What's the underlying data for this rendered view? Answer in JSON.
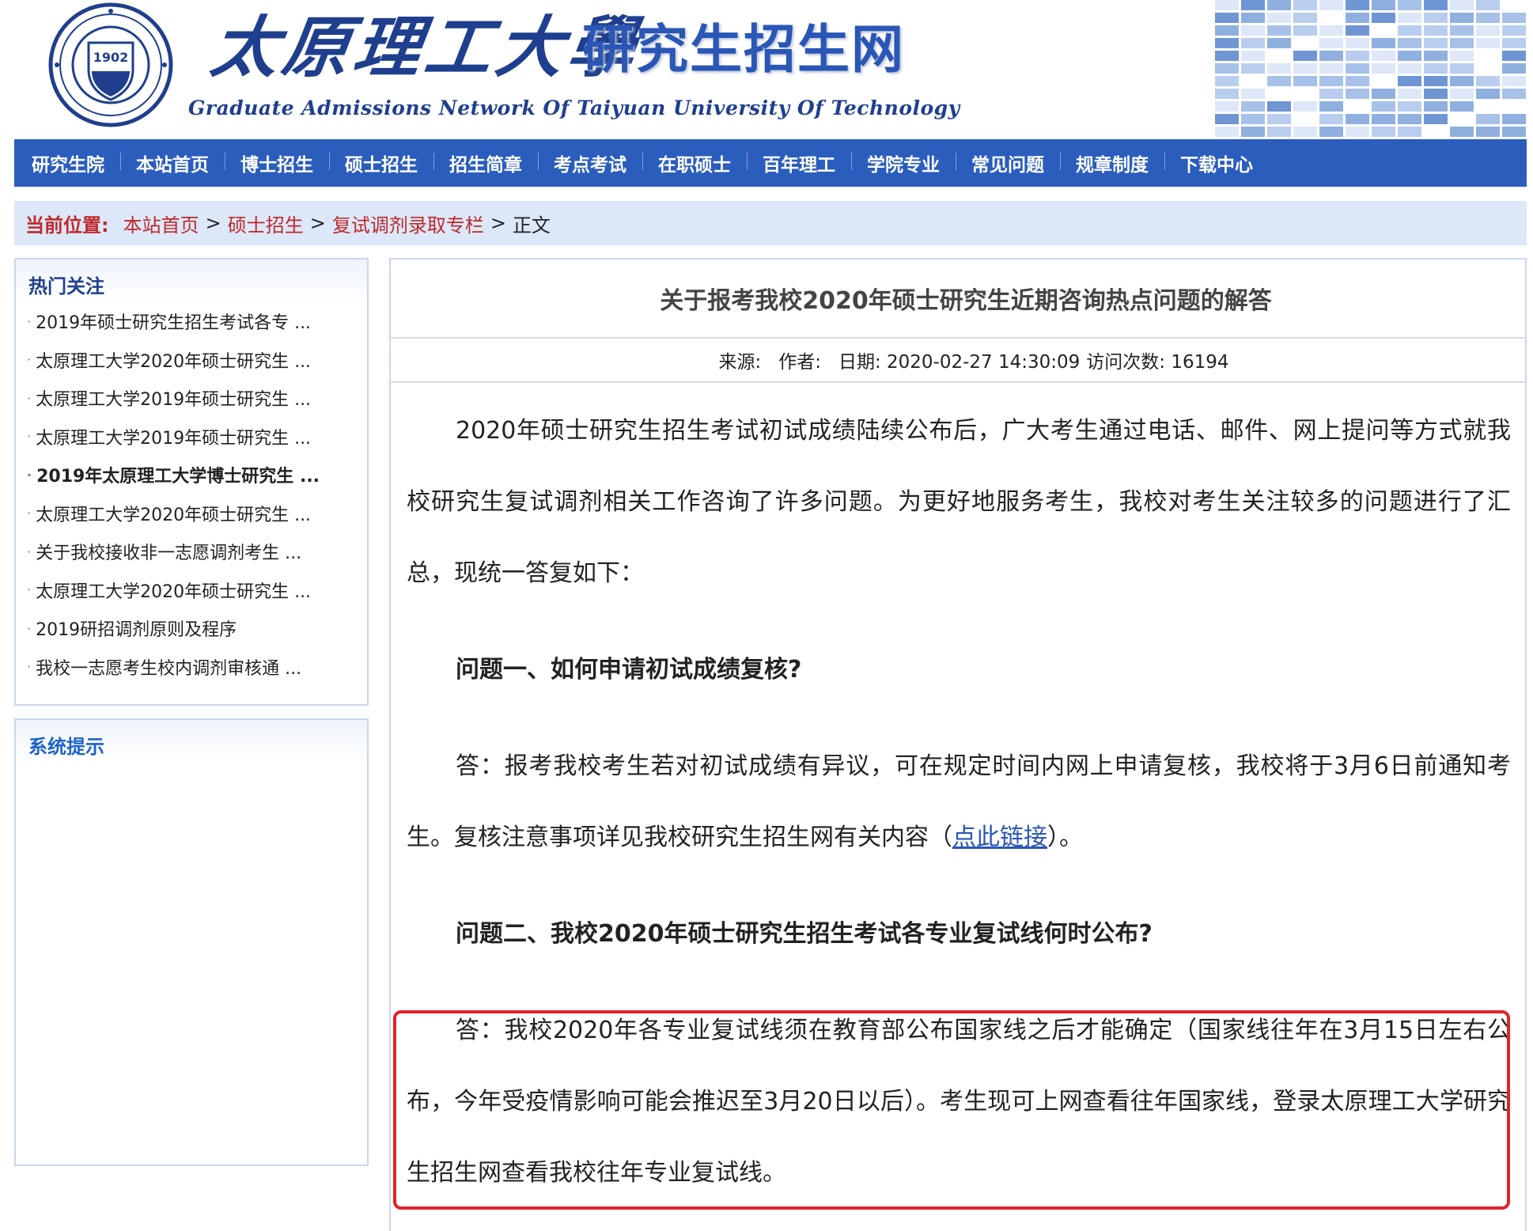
{
  "header": {
    "seal_year": "1902",
    "logo_cn": "太原理工大學",
    "site_name": "研究生招生网",
    "logo_en": "Graduate Admissions Network Of Taiyuan University Of Technology"
  },
  "nav": {
    "items": [
      "研究生院",
      "本站首页",
      "博士招生",
      "硕士招生",
      "招生简章",
      "考点考试",
      "在职硕士",
      "百年理工",
      "学院专业",
      "常见问题",
      "规章制度",
      "下载中心"
    ]
  },
  "breadcrumb": {
    "label": "当前位置:",
    "items": [
      "本站首页",
      "硕士招生",
      "复试调剂录取专栏"
    ],
    "separator": ">",
    "current": "正文"
  },
  "sidebar": {
    "hot_title": "热门关注",
    "hot_items": [
      "2019年硕士研究生招生考试各专 ...",
      "太原理工大学2020年硕士研究生 ...",
      "太原理工大学2019年硕士研究生 ...",
      "太原理工大学2019年硕士研究生 ...",
      "2019年太原理工大学博士研究生 ...",
      "太原理工大学2020年硕士研究生 ...",
      "关于我校接收非一志愿调剂考生 ...",
      "太原理工大学2020年硕士研究生 ...",
      "2019研招调剂原则及程序",
      "我校一志愿考生校内调剂审核通 ..."
    ],
    "system_title": "系统提示"
  },
  "article": {
    "title": "关于报考我校2020年硕士研究生近期咨询热点问题的解答",
    "meta": {
      "source": "来源:",
      "author": "作者:",
      "date": "日期: 2020-02-27 14:30:09",
      "visits": "访问次数: 16194"
    },
    "intro": "2020年硕士研究生招生考试初试成绩陆续公布后，广大考生通过电话、邮件、网上提问等方式就我校研究生复试调剂相关工作咨询了许多问题。为更好地服务考生，我校对考生关注较多的问题进行了汇总，现统一答复如下：",
    "q1": "问题一、如何申请初试成绩复核?",
    "a1_text": "答：报考我校考生若对初试成绩有异议，可在规定时间内网上申请复核，我校将于3月6日前通知考生。复核注意事项详见我校研究生招生网有关内容（",
    "a1_link": "点此链接",
    "a1_tail": "）。",
    "q2": "问题二、我校2020年硕士研究生招生考试各专业复试线何时公布?",
    "a2": "答：我校2020年各专业复试线须在教育部公布国家线之后才能确定（国家线往年在3月15日左右公布，今年受疫情影响可能会推迟至3月20日以后）。考生现可上网查看往年国家线，登录太原理工大学研究生招生网查看我校往年专业复试线。"
  },
  "colors": {
    "nav_bg": "#2b5dbd",
    "breadcrumb_bg": "#dce8f8",
    "accent_red": "#c0282b",
    "highlight_border": "#e0232a",
    "link": "#2a56b6"
  }
}
